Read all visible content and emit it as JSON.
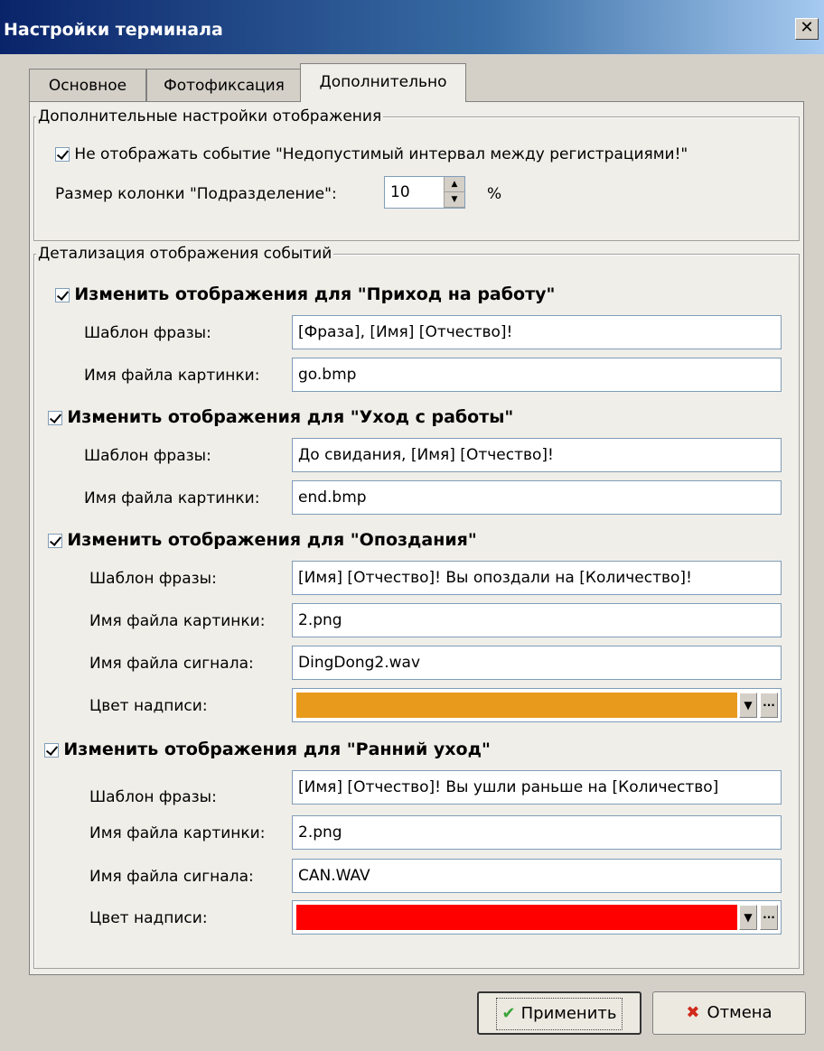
{
  "window": {
    "title": "Настройки терминала",
    "close_glyph": "✕"
  },
  "tabs": [
    {
      "label": "Основное"
    },
    {
      "label": "Фотофиксация"
    },
    {
      "label": "Дополнительно"
    }
  ],
  "display_settings": {
    "legend": "Дополнительные настройки отображения",
    "hide_event_checkbox": {
      "checked": true,
      "label": "Не отображать событие \"Недопустимый интервал между регистрациями!\""
    },
    "column_size": {
      "label": "Размер колонки \"Подразделение\":",
      "value": "10",
      "unit": "%"
    }
  },
  "events": {
    "legend": "Детализация отображения событий",
    "field_labels": {
      "phrase": "Шаблон фразы:",
      "image": "Имя файла картинки:",
      "sound": "Имя файла сигнала:",
      "color": "Цвет надписи:"
    },
    "arrival": {
      "checked": true,
      "title": "Изменить отображения для \"Приход на работу\"",
      "phrase": "[Фраза], [Имя] [Отчество]!",
      "image": "go.bmp"
    },
    "departure": {
      "checked": true,
      "title": "Изменить отображения для \"Уход с работы\"",
      "phrase": "До свидания, [Имя] [Отчество]!",
      "image": "end.bmp"
    },
    "late": {
      "checked": true,
      "title": "Изменить отображения для \"Опоздания\"",
      "phrase": "[Имя] [Отчество]! Вы опоздали на [Количество]!",
      "image": "2.png",
      "sound": "DingDong2.wav",
      "color": "#e89a1c"
    },
    "early_leave": {
      "checked": true,
      "title": "Изменить отображения для \"Ранний уход\"",
      "phrase": "[Имя] [Отчество]! Вы ушли раньше на [Количество]",
      "image": "2.png",
      "sound": "CAN.WAV",
      "color": "#ff0000"
    }
  },
  "buttons": {
    "apply": "Применить",
    "cancel": "Отмена"
  },
  "icons": {
    "dropdown": "▼",
    "more": "···",
    "spin_up": "▲",
    "spin_down": "▼",
    "ok": "✔",
    "cancel": "✖"
  }
}
